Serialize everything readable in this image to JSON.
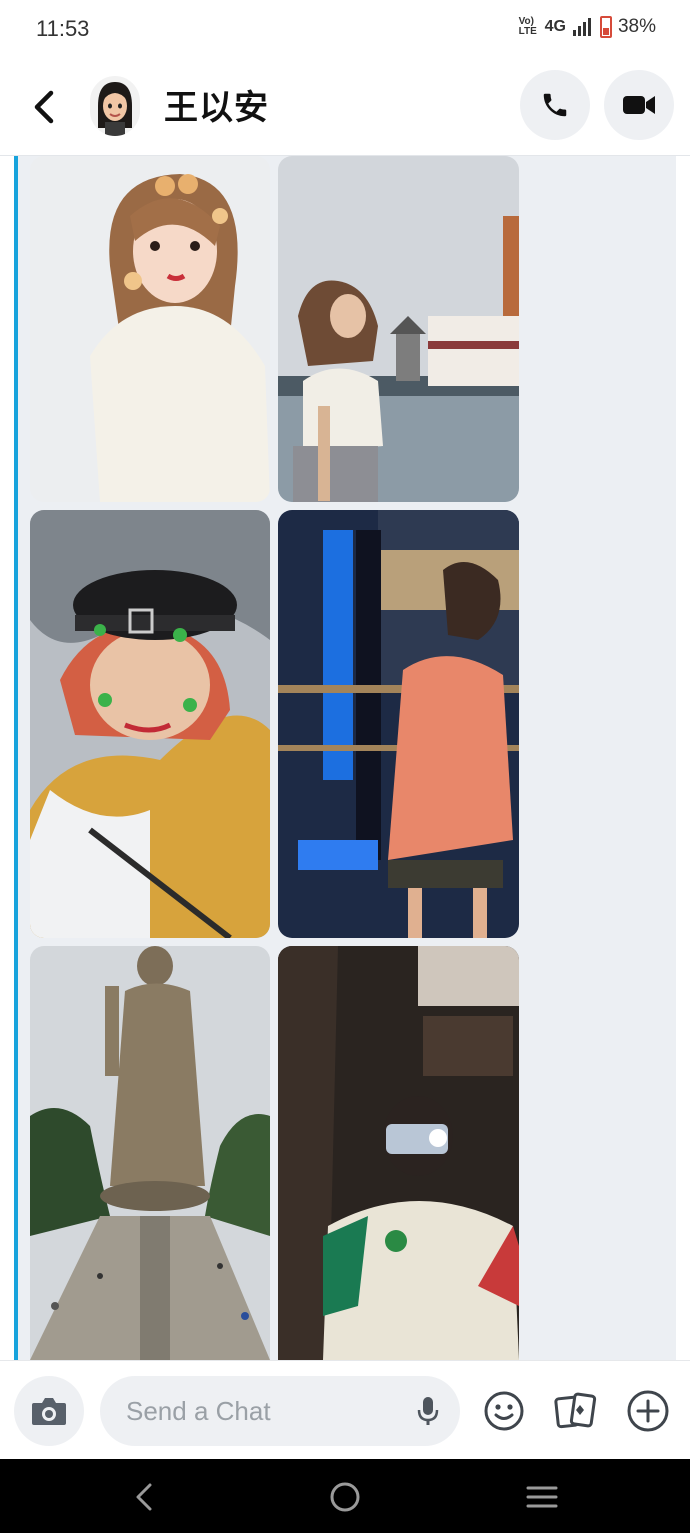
{
  "status_bar": {
    "time": "11:53",
    "volte": "Vo) LTE",
    "network": "4G",
    "battery": "38%"
  },
  "header": {
    "contact_name": "王以安",
    "avatar_icon": "bitmoji-avatar-icon"
  },
  "chat": {
    "accent_color": "#17a3dc",
    "photos": [
      {
        "name": "photo-girl-cat-filter"
      },
      {
        "name": "photo-girl-temple"
      },
      {
        "name": "photo-girl-beret"
      },
      {
        "name": "photo-girl-city-lights"
      },
      {
        "name": "photo-buddha-statue"
      },
      {
        "name": "photo-girl-mirror-selfie"
      }
    ]
  },
  "composer": {
    "placeholder": "Send a Chat"
  },
  "icons": {
    "back": "back-arrow-icon",
    "call": "phone-icon",
    "video": "video-camera-icon",
    "camera": "camera-icon",
    "mic": "microphone-icon",
    "emoji": "smiley-icon",
    "cards": "cards-icon",
    "plus": "plus-circle-icon"
  }
}
